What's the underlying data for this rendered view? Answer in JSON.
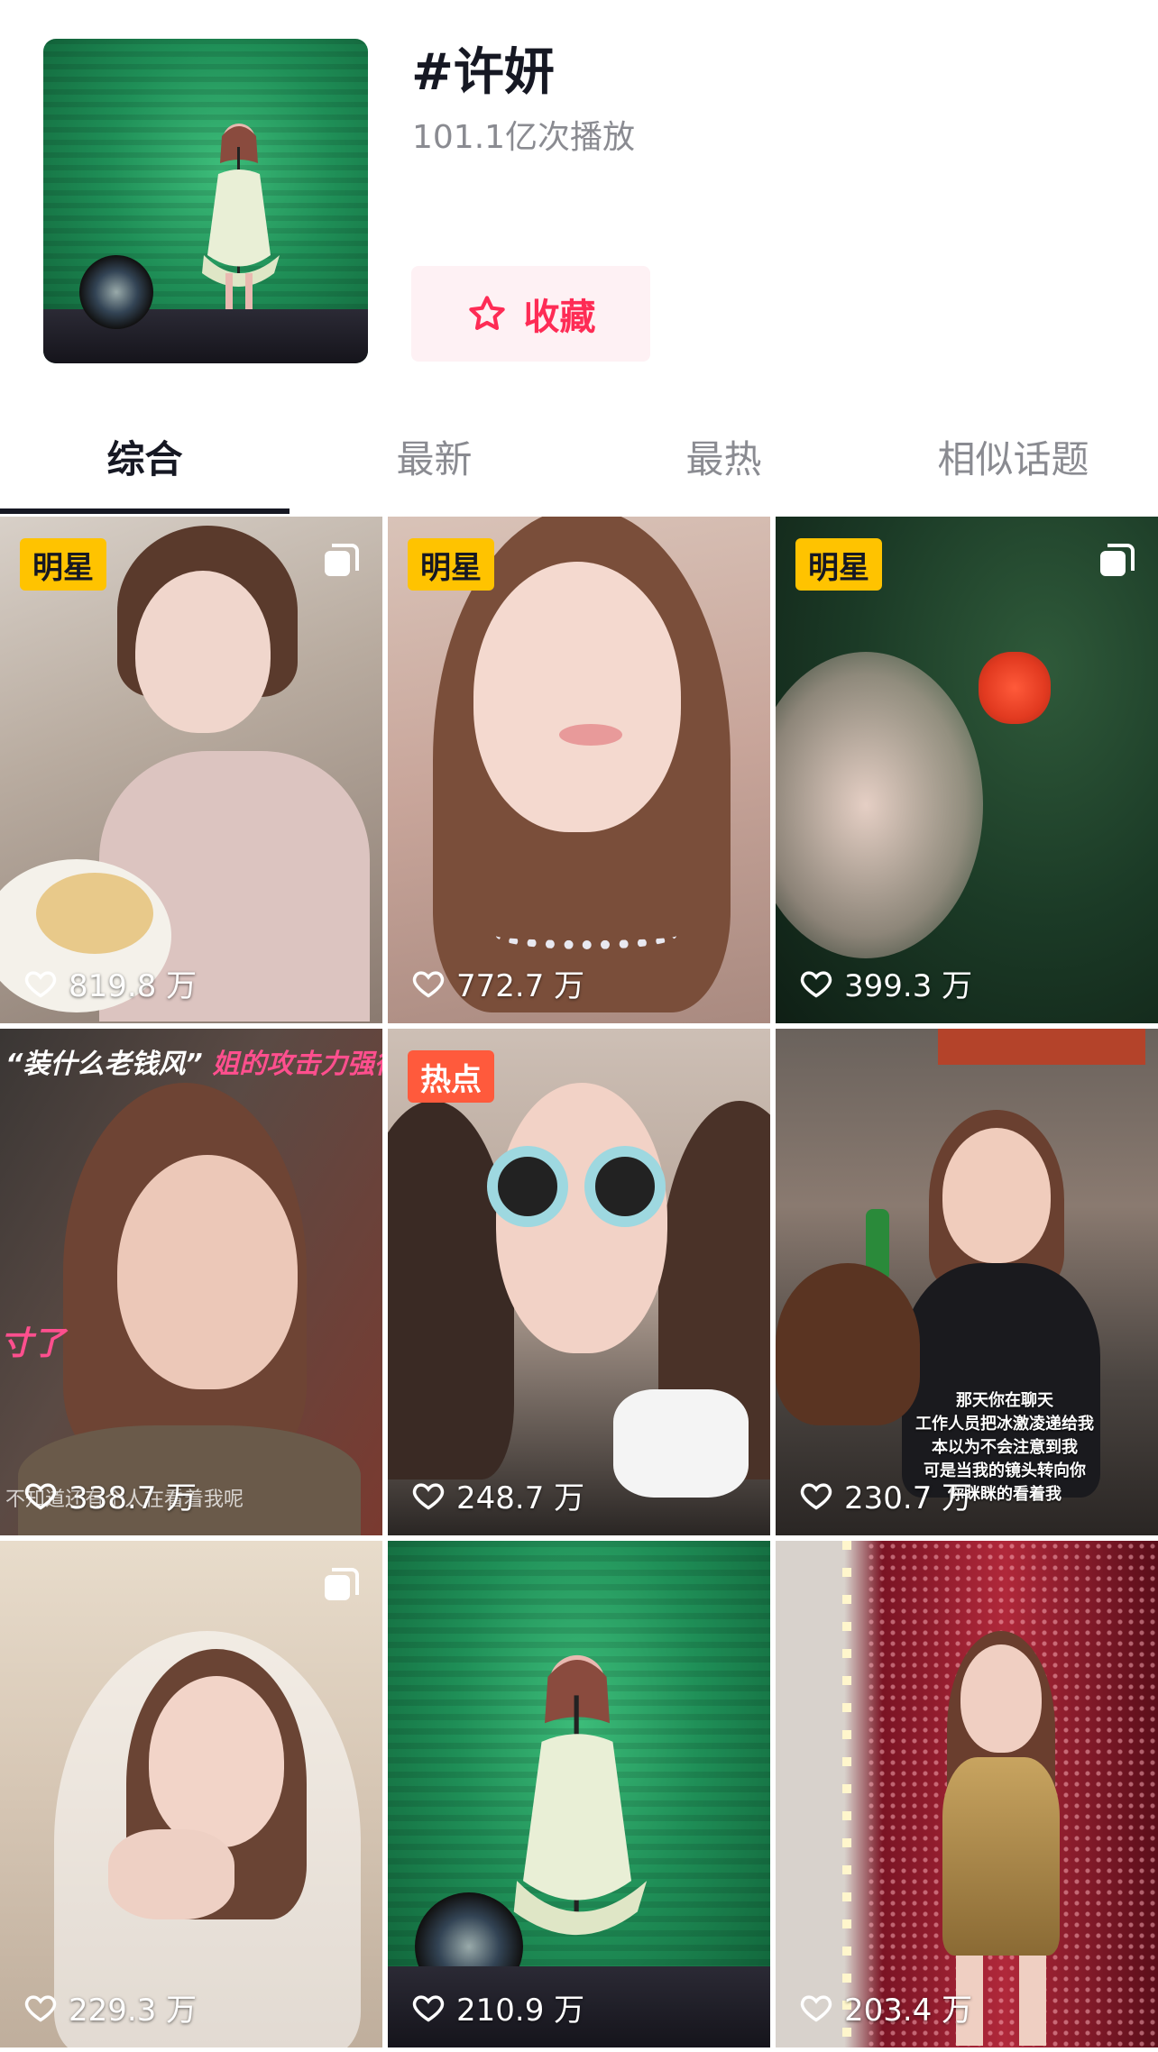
{
  "topic": {
    "title": "#许妍",
    "plays": "101.1亿次播放",
    "favorite_label": "收藏"
  },
  "tabs": [
    {
      "label": "综合",
      "active": true
    },
    {
      "label": "最新",
      "active": false
    },
    {
      "label": "最热",
      "active": false
    },
    {
      "label": "相似话题",
      "active": false
    }
  ],
  "videos": [
    {
      "badge": "明星",
      "likes": "819.8 万",
      "multi": true
    },
    {
      "badge": "明星",
      "likes": "772.7 万",
      "multi": false
    },
    {
      "badge": "明星",
      "likes": "399.3 万",
      "multi": true
    },
    {
      "overlay": {
        "quote": "“装什么老钱风”",
        "pink": "姐的攻击力强得"
      },
      "side_text": "寸了",
      "subtitle": "不知道还有个人在看着我呢",
      "likes": "338.7 万"
    },
    {
      "badge": "热点",
      "likes": "248.7 万"
    },
    {
      "caption": [
        "那天你在聊天",
        "工作人员把冰激凌递给我",
        "本以为不会注意到我",
        "可是当我的镜头转向你",
        "你眯眯的看着我"
      ],
      "likes": "230.7 万"
    },
    {
      "likes": "229.3 万",
      "multi": true
    },
    {
      "likes": "210.9 万"
    },
    {
      "likes": "203.4 万"
    }
  ],
  "colors": {
    "accent": "#fe2c55",
    "badge_star": "#ffc300",
    "badge_hot": "#ff5a3c"
  }
}
